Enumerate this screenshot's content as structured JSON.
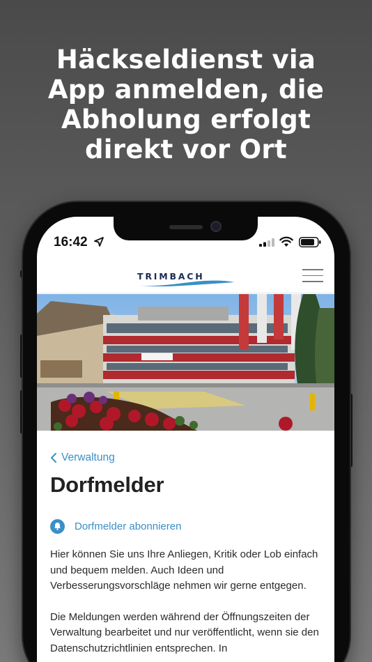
{
  "headline": {
    "lines": [
      "Häckseldienst via",
      "App anmelden, die",
      "Abholung erfolgt",
      "direkt vor Ort"
    ]
  },
  "status_bar": {
    "time": "16:42",
    "icons": [
      "location-arrow-icon",
      "signal-bars-icon",
      "wifi-icon",
      "battery-icon"
    ]
  },
  "navbar": {
    "logo_text": "TRIMBACH",
    "logo_wave_color": "#3a8fc7",
    "menu_icon": "hamburger-menu-icon"
  },
  "hero": {
    "alt": "Gemeindehaus Trimbach"
  },
  "page": {
    "back_label": "Verwaltung",
    "title": "Dorfmelder",
    "subscribe_label": "Dorfmelder abonnieren",
    "paragraphs": [
      "Hier können Sie uns Ihre Anliegen, Kritik oder Lob einfach und bequem melden. Auch Ideen und Verbesserungsvorschläge nehmen wir gerne entgegen.",
      "Die Meldungen werden während der Öffnungszeiten der Verwaltung bearbeitet und nur veröffentlicht, wenn sie den Datenschutzrichtlinien entsprechen. In"
    ]
  },
  "colors": {
    "accent": "#3a8fc7",
    "logo_text": "#1c2b55",
    "background_top": "#4a4a4a",
    "background_bottom": "#7a7a7a"
  }
}
